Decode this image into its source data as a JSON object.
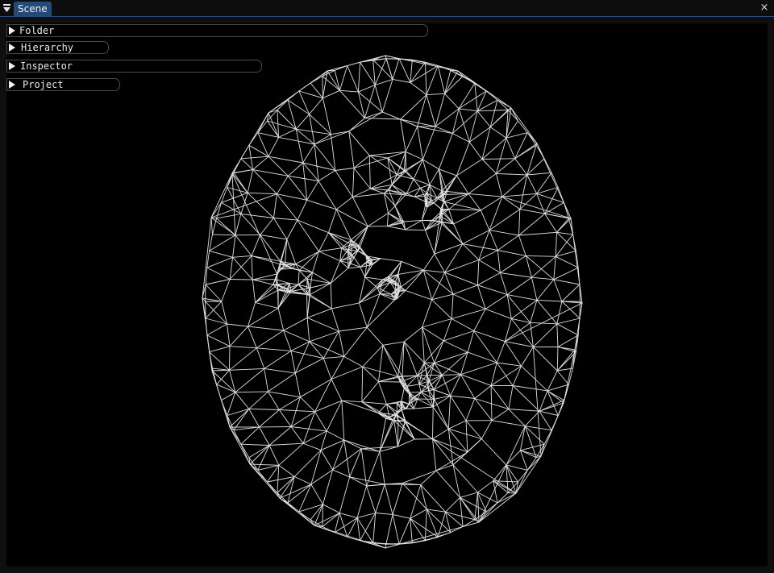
{
  "window": {
    "tab_label": "Scene",
    "close_glyph": "×"
  },
  "panels": [
    {
      "label": "Folder",
      "icon": "triangle-right-icon"
    },
    {
      "label": "Hierarchy",
      "icon": "triangle-right-icon"
    },
    {
      "label": "Inspector",
      "icon": "triangle-right-icon"
    },
    {
      "label": "Project",
      "icon": "triangle-right-icon"
    }
  ],
  "scene": {
    "content": "triangulated wireframe mesh (ellipse)",
    "background_color": "#000000",
    "line_color": "#e0e0e0"
  },
  "colors": {
    "accent": "#264a78",
    "title_border": "#2b4f80",
    "window_bg": "#0f0f0f"
  }
}
